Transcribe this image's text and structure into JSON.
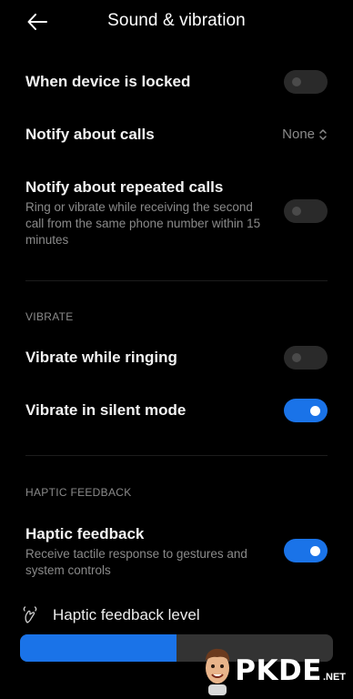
{
  "header": {
    "title": "Sound & vibration",
    "back_icon": "arrow-left-icon"
  },
  "settings": {
    "locked": {
      "label": "When device is locked",
      "enabled": false
    },
    "notify_calls": {
      "label": "Notify about calls",
      "value": "None",
      "icon": "chevron-up-down-icon"
    },
    "repeated_calls": {
      "label": "Notify about repeated calls",
      "description": "Ring or vibrate while receiving the second call from the same phone number within 15 minutes",
      "enabled": false
    }
  },
  "vibrate_section": {
    "label": "VIBRATE",
    "ringing": {
      "label": "Vibrate while ringing",
      "enabled": false
    },
    "silent": {
      "label": "Vibrate in silent mode",
      "enabled": true
    }
  },
  "haptic_section": {
    "label": "HAPTIC FEEDBACK",
    "haptic": {
      "label": "Haptic feedback",
      "description": "Receive tactile response to gestures and system controls",
      "enabled": true
    },
    "level": {
      "label": "Haptic feedback level",
      "icon": "vibration-icon",
      "value_fraction": 0.5
    }
  },
  "colors": {
    "accent": "#1a73e8",
    "background": "#000000",
    "secondary_text": "#8a8a8a"
  },
  "watermark": {
    "text": "PKDE",
    "suffix": ".NET",
    "icon": "mascot-face-icon"
  }
}
